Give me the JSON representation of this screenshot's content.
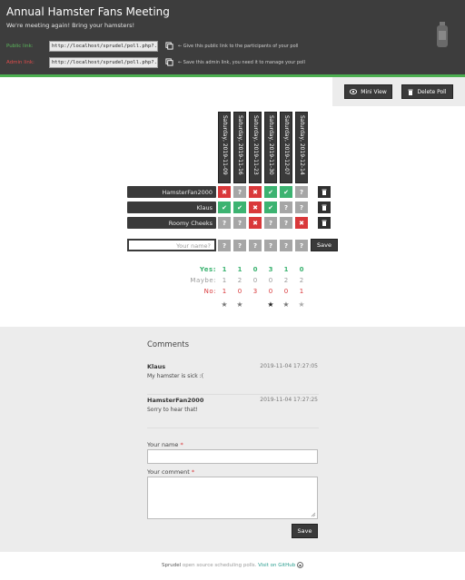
{
  "header": {
    "title": "Annual Hamster Fans Meeting",
    "subtitle": "We're meeting again! Bring your hamsters!",
    "public_label": "Public link:",
    "public_url": "http://localhost/sprudel/poll.php?...",
    "public_hint": "← Give this public link to the participants of your poll",
    "admin_label": "Admin link:",
    "admin_url": "http://localhost/sprudel/poll.php?...",
    "admin_hint": "← Save this admin link, you need it to manage your poll",
    "colors": {
      "background": "#3d3d3d",
      "accent": "#4caf50",
      "public": "#5cb85c",
      "admin": "#e24c4b"
    }
  },
  "toolbar": {
    "mini_view": "Mini View",
    "delete_poll": "Delete Poll"
  },
  "poll": {
    "dates": [
      "Saturday, 2019-11-09",
      "Saturday, 2019-11-16",
      "Saturday, 2019-11-23",
      "Saturday, 2019-11-30",
      "Saturday, 2019-12-07",
      "Saturday, 2019-12-14"
    ],
    "participants": [
      {
        "name": "HamsterFan2000",
        "votes": [
          "no",
          "maybe",
          "no",
          "yes",
          "yes",
          "maybe"
        ]
      },
      {
        "name": "Klaus",
        "votes": [
          "yes",
          "yes",
          "no",
          "yes",
          "maybe",
          "maybe"
        ]
      },
      {
        "name": "Roomy Cheeks",
        "votes": [
          "maybe",
          "maybe",
          "no",
          "maybe",
          "maybe",
          "no"
        ]
      }
    ],
    "new_vote_placeholder": "Your name?",
    "new_vote_cells": [
      "?",
      "?",
      "?",
      "?",
      "?",
      "?"
    ],
    "save_label": "Save",
    "symbols": {
      "yes": "✔",
      "no": "✖",
      "maybe": "?",
      "edit": "trash-icon"
    },
    "colors": {
      "yes": "#3cb371",
      "no": "#d9383a",
      "maybe": "#a6a6a6"
    }
  },
  "summary": {
    "yes_label": "Yes:",
    "maybe_label": "Maybe:",
    "no_label": "No:",
    "yes": [
      1,
      1,
      0,
      3,
      1,
      0
    ],
    "maybe": [
      1,
      2,
      0,
      0,
      2,
      2
    ],
    "no": [
      1,
      0,
      3,
      0,
      0,
      1
    ],
    "stars": [
      "gray",
      "gray",
      "none",
      "black",
      "gray",
      "light"
    ]
  },
  "comments": {
    "title": "Comments",
    "items": [
      {
        "author": "Klaus",
        "time": "2019-11-04 17:27:05",
        "text": "My hamster is sick :("
      },
      {
        "author": "HamsterFan2000",
        "time": "2019-11-04 17:27:25",
        "text": "Sorry to hear that!"
      }
    ],
    "name_label": "Your name",
    "comment_label": "Your comment",
    "required_mark": "*",
    "save_label": "Save"
  },
  "footer": {
    "brand": "Sprudel",
    "text": "open source scheduling polls.",
    "github": "Visit on GitHub"
  }
}
